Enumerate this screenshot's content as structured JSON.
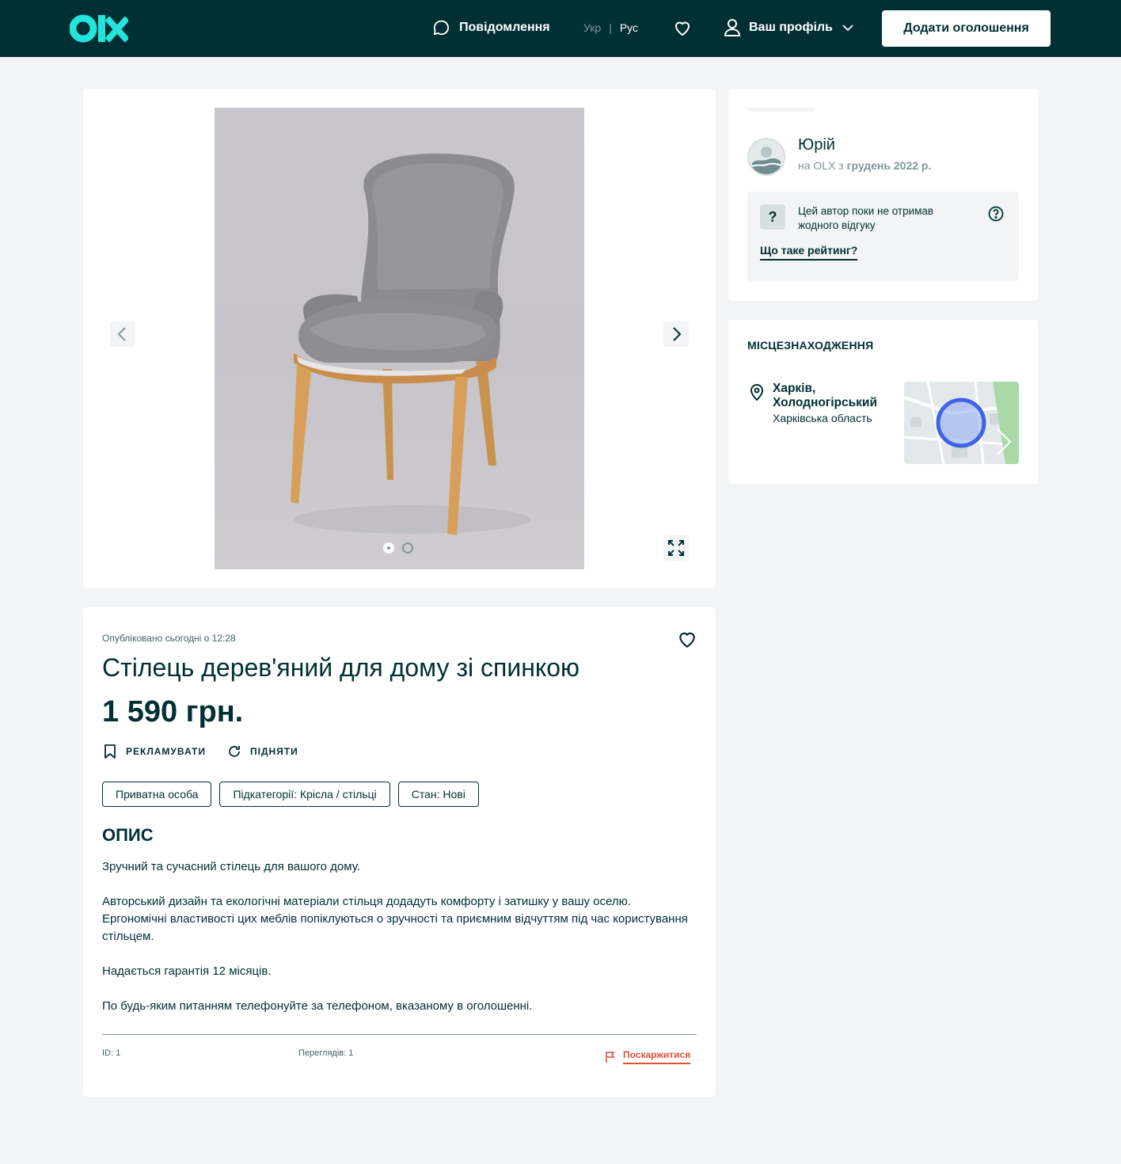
{
  "header": {
    "logo_text": "olx",
    "messages": "Повідомлення",
    "lang_ukr": "Укр",
    "lang_sep": "|",
    "lang_rus": "Рус",
    "profile": "Ваш профіль",
    "post_ad": "Додати оголошення"
  },
  "gallery": {
    "photo_count": 2,
    "active_index": 1
  },
  "listing": {
    "published": "Опубліковано сьогодні о 12:28",
    "title": "Стілець дерев'яний для дому зі спинкою",
    "price": "1 590 грн.",
    "promote": "РЕКЛАМУВАТИ",
    "raise": "ПІДНЯТИ",
    "tags": [
      "Приватна особа",
      "Підкатегорії: Крісла / стільці",
      "Стан: Нові"
    ],
    "description_heading": "ОПИС",
    "description": [
      "Зручний та сучасний стілець для вашого дому.",
      "Авторський дизайн та екологічні матеріали стільця додадуть комфорту і затишку у вашу оселю. Ергономічні властивості цих меблів попіклуються о зручності та приємним відчуттям під час користування стільцем.",
      "Надається гарантія 12 місяців.",
      "По будь-яким питанням телефонуйте за телефоном, вказаному в оголошенні."
    ],
    "id": "ID: 1",
    "views": "Переглядів: 1",
    "report": "Поскаржитися"
  },
  "seller": {
    "name": "Юрій",
    "since_prefix": "на OLX з",
    "since_date": "грудень 2022 р.",
    "rating_text": "Цей автор поки не отримав жодного відгуку",
    "rating_badge": "?",
    "rating_link": "Що таке рейтинг?"
  },
  "location": {
    "heading": "МІСЦЕЗНАХОДЖЕННЯ",
    "city": "Харків, Холодногірський",
    "region": "Харківська область"
  },
  "colors": {
    "brand_dark": "#002f34",
    "brand_accent": "#23e5db",
    "danger": "#e0513b",
    "background": "#f2f4f5"
  }
}
